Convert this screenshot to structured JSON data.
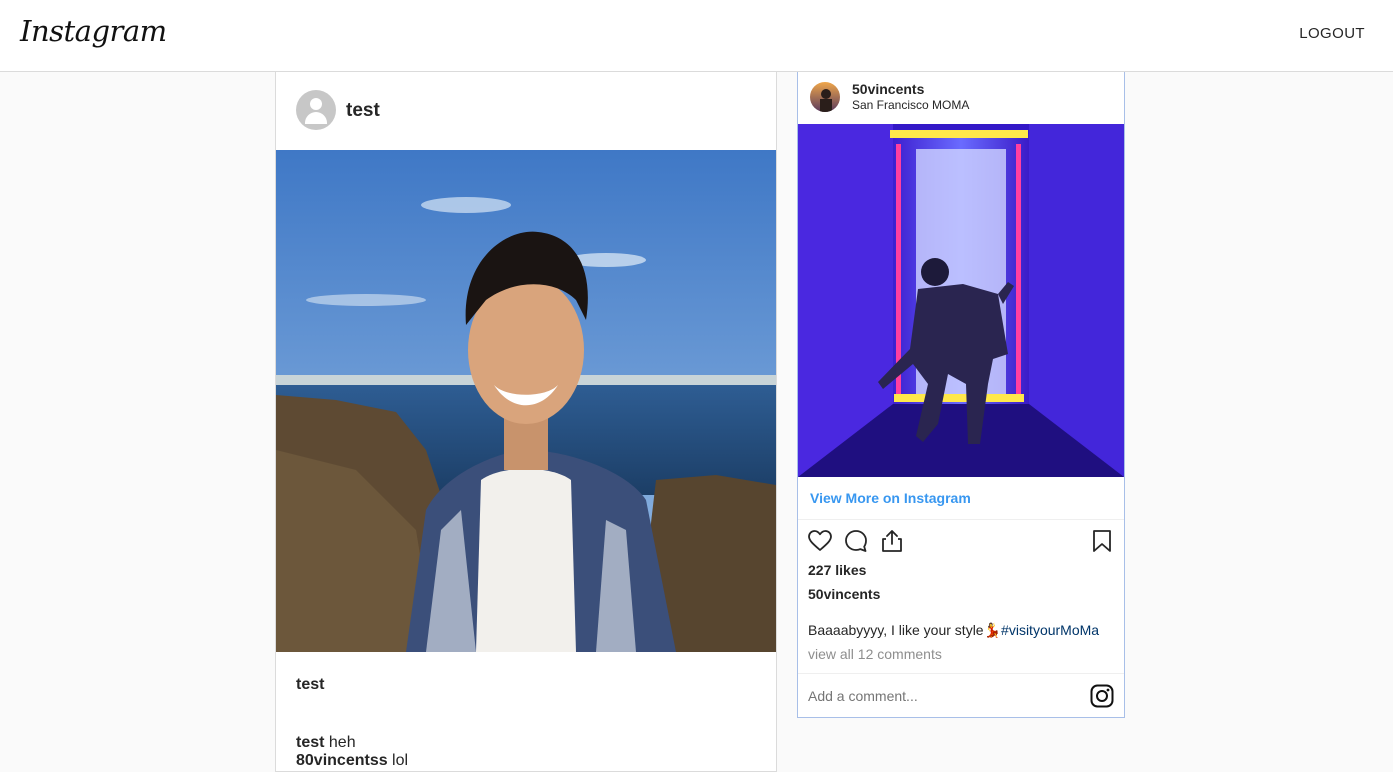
{
  "header": {
    "logo": "Instagram",
    "logout_label": "LOGOUT"
  },
  "post": {
    "username": "test",
    "caption_username": "test",
    "comments": [
      {
        "user": "test",
        "text": " heh"
      },
      {
        "user": "80vincentss",
        "text": " lol"
      }
    ]
  },
  "embed": {
    "username": "50vincents",
    "location": "San Francisco MOMA",
    "view_more": "View More on Instagram",
    "likes": "227 likes",
    "caption_user": "50vincents",
    "caption_text": "Baaaabyyyy, I like your style",
    "caption_emoji": "💃",
    "caption_hashtag": "#visityourMoMa",
    "view_comments": "view all 12 comments",
    "comment_placeholder": "Add a comment..."
  },
  "colors": {
    "link_blue": "#3897f0",
    "hashtag": "#003569",
    "border": "#dbdbdb",
    "background": "#fafafa"
  }
}
